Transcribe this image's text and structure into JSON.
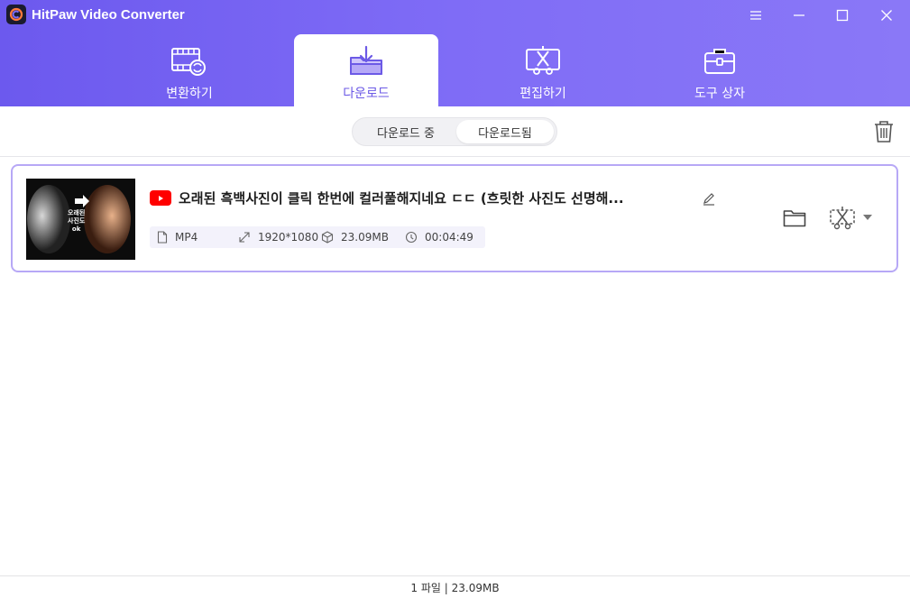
{
  "app": {
    "title": "HitPaw Video Converter"
  },
  "nav": {
    "tabs": [
      {
        "label": "변환하기",
        "icon": "film-convert-icon",
        "active": false
      },
      {
        "label": "다운로드",
        "icon": "download-folder-icon",
        "active": true
      },
      {
        "label": "편집하기",
        "icon": "edit-cut-icon",
        "active": false
      },
      {
        "label": "도구 상자",
        "icon": "toolbox-icon",
        "active": false
      }
    ]
  },
  "subbar": {
    "segments": [
      "다운로드 중",
      "다운로드됨"
    ],
    "selected": "다운로드됨"
  },
  "item": {
    "title": "오래된 흑백사진이 클릭 한번에 컬러풀해지네요 ㄷㄷ (흐릿한 사진도 선명해...",
    "thumb_text": [
      "오래된",
      "사진도",
      "ok"
    ],
    "format": "MP4",
    "resolution": "1920*1080",
    "size": "23.09MB",
    "duration": "00:04:49"
  },
  "footer": {
    "summary": "1 파일 | 23.09MB"
  },
  "colors": {
    "accent": "#6c5ae6",
    "header_start": "#6c59ee",
    "header_end": "#8a78f7",
    "card_border": "#b7a8f6",
    "youtube": "#ff0000"
  }
}
